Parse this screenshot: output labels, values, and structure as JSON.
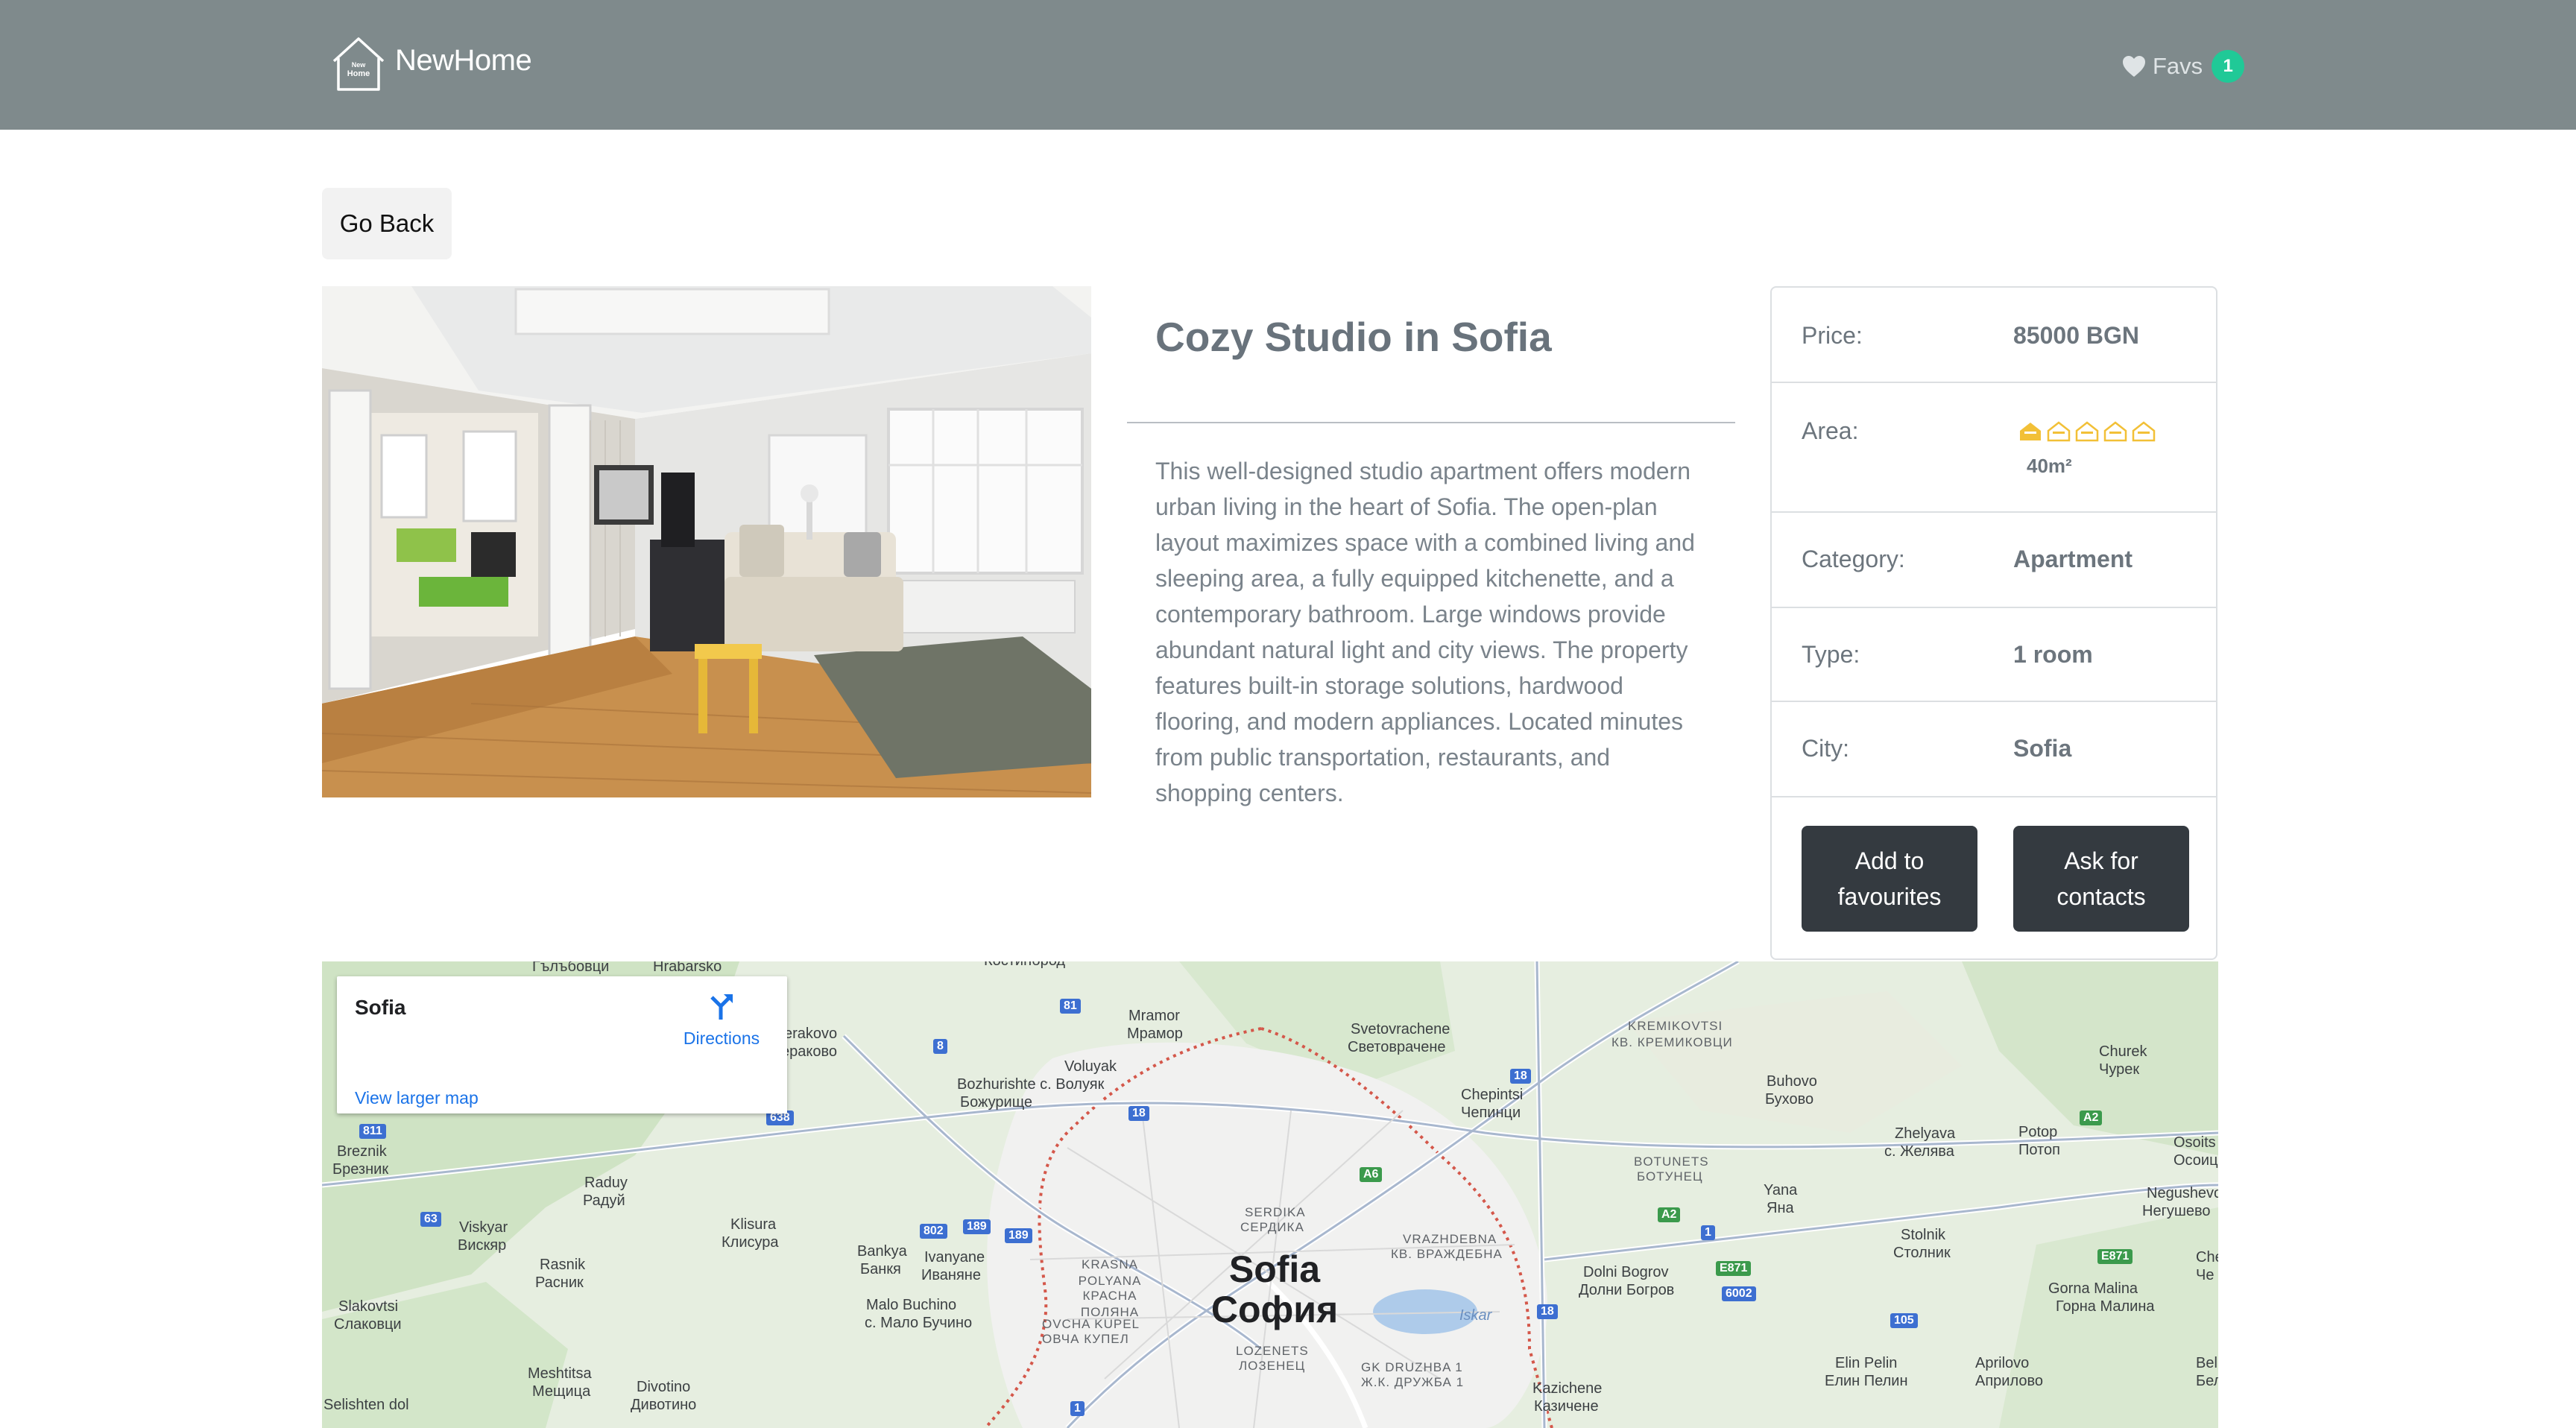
{
  "nav": {
    "brand": "NewHome",
    "logo_small_text_1": "New",
    "logo_small_text_2": "Home",
    "favs_label": "Favs",
    "favs_count": "1"
  },
  "actions": {
    "go_back": "Go Back",
    "add_to_favourites": "Add to favourites",
    "ask_for_contacts": "Ask for contacts"
  },
  "property": {
    "title": "Cozy Studio in Sofia",
    "description": "This well-designed studio apartment offers modern urban living in the heart of Sofia. The open-plan layout maximizes space with a combined living and sleeping area, a fully equipped kitchenette, and a contemporary bathroom. Large windows provide abundant natural light and city views. The property features built-in storage solutions, hardwood flooring, and modern appliances. Located minutes from public transportation, restaurants, and shopping centers."
  },
  "details": {
    "price": {
      "label": "Price:",
      "value": "85000 BGN"
    },
    "area": {
      "label": "Area:",
      "value": "40m²",
      "level_filled": 1,
      "level_total": 5
    },
    "category": {
      "label": "Category:",
      "value": "Apartment"
    },
    "type": {
      "label": "Type:",
      "value": "1 room"
    },
    "city": {
      "label": "City:",
      "value": "Sofia"
    }
  },
  "map": {
    "place_title": "Sofia",
    "directions": "Directions",
    "view_larger": "View larger map",
    "city_name_latin": "Sofia",
    "city_name_cyrillic": "София",
    "labels": [
      "Гълъбовци",
      "Hrabarsko",
      "Костинброд",
      "Mramor",
      "Мрамор",
      "Voluyak",
      "Bozhurishte с. Волуяк",
      "Божурище",
      "Svetovrachene",
      "Световрачене",
      "KREMIKOVTSI",
      "КВ. КРЕМИКОВЦИ",
      "Churek",
      "Чурек",
      "Buhovo",
      "Бухово",
      "Chepintsi",
      "Чепинци",
      "Zhelyava",
      "с. Желява",
      "Potop",
      "Потоп",
      "Osoits",
      "Осоиц",
      "Breznik",
      "Брезник",
      "Raduy",
      "Радуй",
      "BOTUNETS",
      "БОТУНЕЦ",
      "Yana",
      "Яна",
      "Negushevo",
      "Негушево",
      "Viskyar",
      "Вискяр",
      "Klisura",
      "Клисура",
      "SERDIKA",
      "СЕРДИКА",
      "Stolnik",
      "Столник",
      "Bankya",
      "Банкя",
      "Ivanyane",
      "Иваняне",
      "KRASNA POLYANA",
      "КРАСНА ПОЛЯНА",
      "VRAZHDEBNA",
      "КВ. ВРАЖДЕБНА",
      "Dolni Bogrov",
      "Долни Богров",
      "Rasnik",
      "Расник",
      "Gorna Malina",
      "Горна Малина",
      "Slakovtsi",
      "Слаковци",
      "Malo Buchino",
      "с. Мало Бучино",
      "OVCHA KUPEL",
      "ОВЧА КУПЕЛ",
      "LOZENETS",
      "ЛОЗЕНЕЦ",
      "GK DRUZHBA 1",
      "Ж.К. ДРУЖБА 1",
      "Elin Pelin",
      "Елин Пелин",
      "Aprilovo",
      "Априлово",
      "Meshtitsa",
      "Мещица",
      "Divotino",
      "Дивотино",
      "Selishten dol",
      "Kazichene",
      "Казичене",
      "erakovo",
      "ераково",
      "Iskar",
      "Bel",
      "Бел",
      "Che",
      "Че"
    ],
    "road_shields": [
      "81",
      "8",
      "638",
      "811",
      "63",
      "802",
      "189",
      "189",
      "18",
      "A6",
      "18",
      "A2",
      "1",
      "E871",
      "6002",
      "18",
      "105",
      "E871",
      "A2",
      "1"
    ]
  },
  "colors": {
    "navbar": "#7f8a8c",
    "badge": "#20c997",
    "button_dark": "#343a40",
    "area_icon": "#f2c037",
    "link": "#1a73e8"
  }
}
